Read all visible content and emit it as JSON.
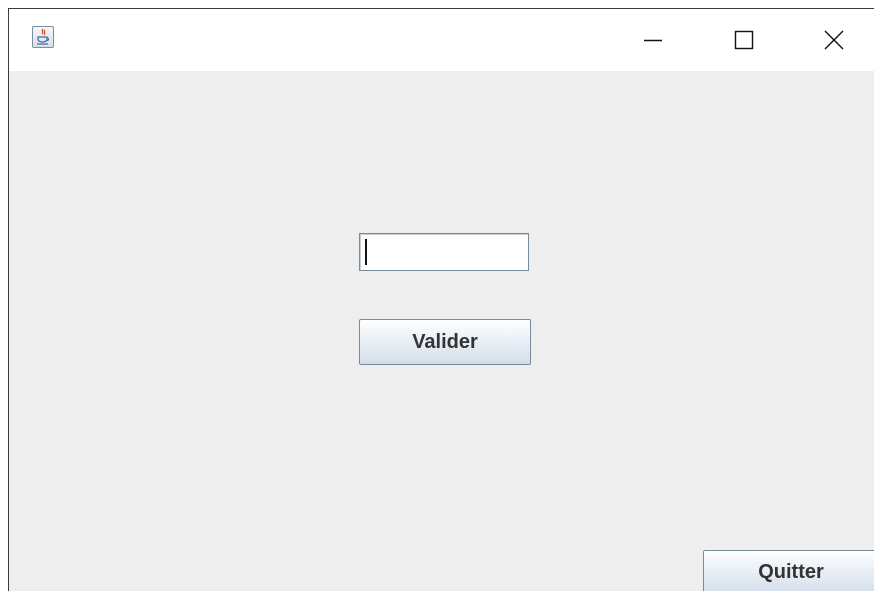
{
  "window": {
    "app_icon": "java-coffee-cup-icon",
    "controls": {
      "minimize_icon": "minimize-icon",
      "maximize_icon": "maximize-icon",
      "close_icon": "close-icon"
    }
  },
  "form": {
    "input_value": "",
    "validate_label": "Valider",
    "quit_label": "Quitter"
  },
  "colors": {
    "client_background": "#eeeeee",
    "titlebar_background": "#ffffff",
    "button_text": "#333333",
    "border": "#7a8a99"
  }
}
